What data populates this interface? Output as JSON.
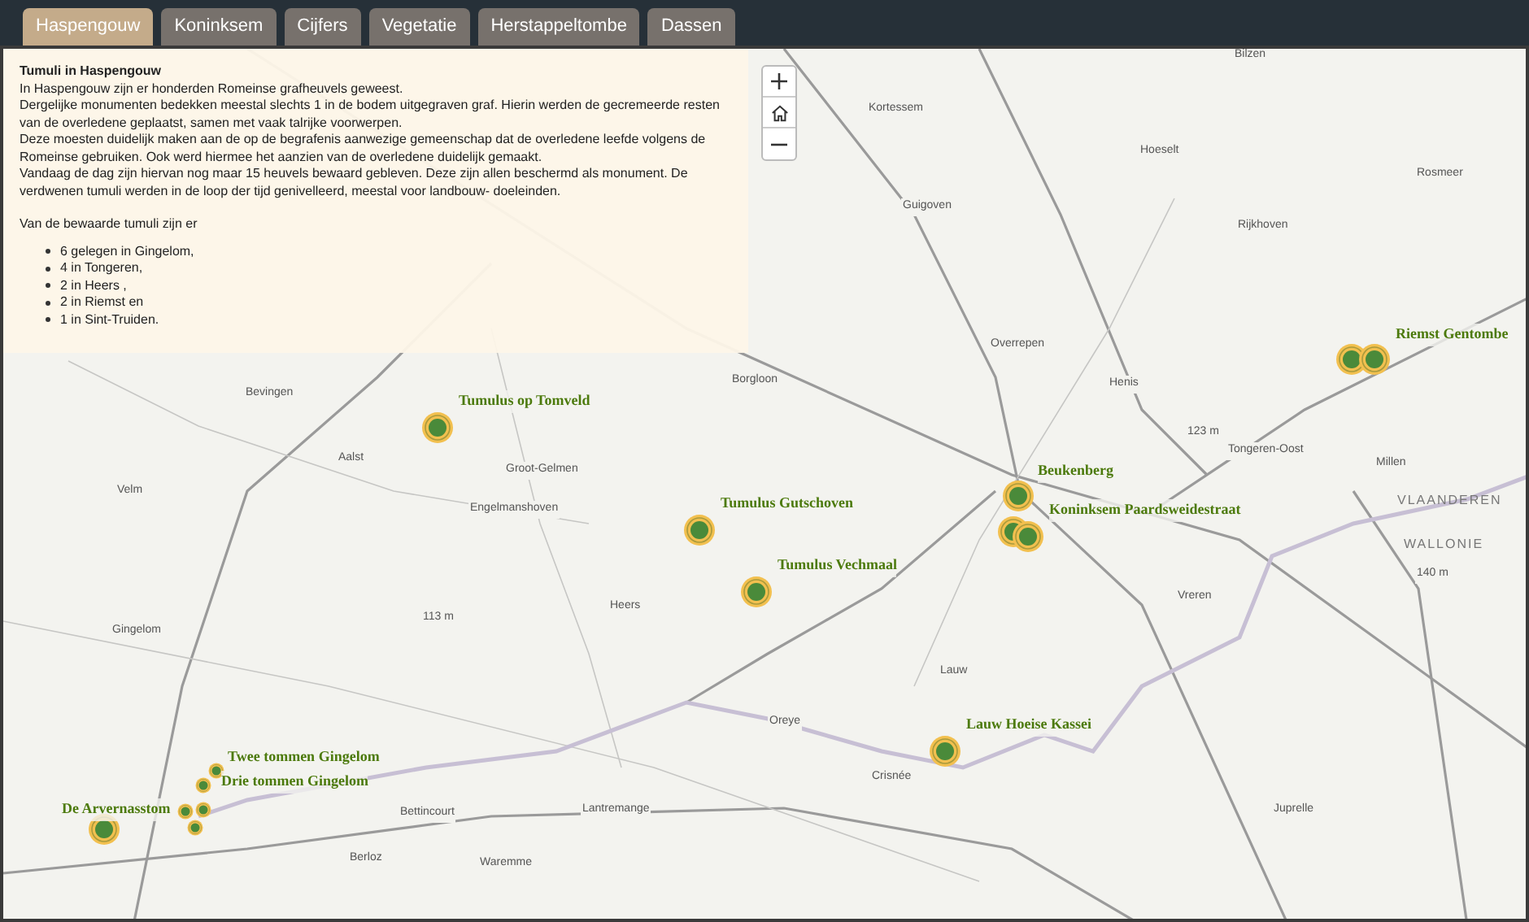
{
  "tabs": [
    {
      "label": "Haspengouw",
      "selected": true
    },
    {
      "label": "Koninksem",
      "selected": false
    },
    {
      "label": "Cijfers",
      "selected": false
    },
    {
      "label": "Vegetatie",
      "selected": false
    },
    {
      "label": "Herstappeltombe",
      "selected": false
    },
    {
      "label": "Dassen",
      "selected": false
    }
  ],
  "info_panel": {
    "title": "Tumuli in Haspengouw",
    "paragraphs": [
      "In Haspengouw zijn er honderden Romeinse grafheuvels geweest.",
      "Dergelijke monumenten bedekken meestal slechts 1 in de bodem uitgegraven graf. Hierin werden de gecremeerde resten van de overledene geplaatst, samen met vaak talrijke voorwerpen.",
      "Deze moesten duidelijk maken aan de op de begrafenis aanwezige gemeenschap dat de overledene leefde volgens de Romeinse gebruiken. Ook werd hiermee het aanzien van de overledene duidelijk gemaakt.",
      "Vandaag de dag zijn hiervan nog maar 15 heuvels bewaard gebleven. Deze zijn allen beschermd als monument. De verdwenen tumuli werden in de loop der tijd genivelleerd, meestal voor landbouw- doeleinden."
    ],
    "list_intro": "Van de bewaarde tumuli zijn er",
    "list": [
      "6 gelegen in Gingelom,",
      "4 in Tongeren,",
      "2 in Heers ,",
      "2 in Riemst en",
      "1 in Sint-Truiden."
    ]
  },
  "tumulus_labels": [
    "Tumulus op Tomveld",
    "Tumulus Gutschoven",
    "Tumulus Vechmaal",
    "Beukenberg",
    "Koninksem Paardsweidestraat",
    "Lauw Hoeise Kassei",
    "Riemst Gentombe",
    "Twee tommen Gingelom",
    "Drie tommen Gingelom",
    "De Arvernasstom"
  ],
  "place_labels": [
    "Bilzen",
    "Kortessem",
    "Guigoven",
    "Hoeselt",
    "Rosmeer",
    "Rijkhoven",
    "Overrepen",
    "Henis",
    "Tongeren-Oost",
    "Millen",
    "Bevingen",
    "Aalst",
    "Velm",
    "Groot-Gelmen",
    "Engelmanshoven",
    "Heers",
    "Gingelom",
    "Borgloon",
    "Vreren",
    "Lauw",
    "Oreye",
    "Crisnée",
    "Bettincourt",
    "Lantremange",
    "Juprelle",
    "Berloz",
    "Waremme",
    "113 m",
    "123 m",
    "140 m"
  ],
  "region_labels": [
    "VLAANDEREN",
    "WALLONIE"
  ]
}
